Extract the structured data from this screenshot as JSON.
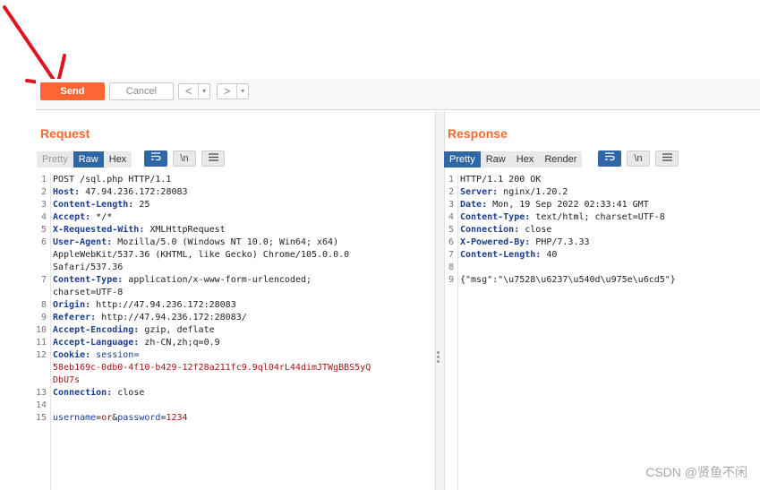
{
  "toolbar": {
    "send_label": "Send",
    "cancel_label": "Cancel",
    "back_label": "<",
    "forward_label": ">",
    "dropdown_glyph": "▾"
  },
  "request": {
    "title": "Request",
    "tabs": [
      "Pretty",
      "Raw",
      "Hex"
    ],
    "active_tab": "Raw",
    "wrap_icon": "wrap-lines-icon",
    "newline_label": "\\n",
    "menu_icon": "hamburger-menu-icon",
    "lines": [
      {
        "n": "1",
        "parts": [
          {
            "t": "POST /sql.php HTTP/1.1",
            "c": "hv"
          }
        ]
      },
      {
        "n": "2",
        "parts": [
          {
            "t": "Host:",
            "c": "hk"
          },
          {
            "t": " 47.94.236.172:28083",
            "c": "hv"
          }
        ]
      },
      {
        "n": "3",
        "parts": [
          {
            "t": "Content-Length:",
            "c": "hk"
          },
          {
            "t": " 25",
            "c": "hv"
          }
        ]
      },
      {
        "n": "4",
        "parts": [
          {
            "t": "Accept:",
            "c": "hk"
          },
          {
            "t": " */*",
            "c": "hv"
          }
        ]
      },
      {
        "n": "5",
        "parts": [
          {
            "t": "X-Requested-With:",
            "c": "hk"
          },
          {
            "t": " XMLHttpRequest",
            "c": "hv"
          }
        ]
      },
      {
        "n": "6",
        "parts": [
          {
            "t": "User-Agent:",
            "c": "hk"
          },
          {
            "t": " Mozilla/5.0 (Windows NT 10.0; Win64; x64)",
            "c": "hv"
          }
        ]
      },
      {
        "n": "",
        "parts": [
          {
            "t": "AppleWebKit/537.36 (KHTML, like Gecko) Chrome/105.0.0.0",
            "c": "hv"
          }
        ]
      },
      {
        "n": "",
        "parts": [
          {
            "t": "Safari/537.36",
            "c": "hv"
          }
        ]
      },
      {
        "n": "7",
        "parts": [
          {
            "t": "Content-Type:",
            "c": "hk"
          },
          {
            "t": " application/x-www-form-urlencoded;",
            "c": "hv"
          }
        ]
      },
      {
        "n": "",
        "parts": [
          {
            "t": "charset=UTF-8",
            "c": "hv"
          }
        ]
      },
      {
        "n": "8",
        "parts": [
          {
            "t": "Origin:",
            "c": "hk"
          },
          {
            "t": " http://47.94.236.172:28083",
            "c": "hv"
          }
        ]
      },
      {
        "n": "9",
        "parts": [
          {
            "t": "Referer:",
            "c": "hk"
          },
          {
            "t": " http://47.94.236.172:28083/",
            "c": "hv"
          }
        ]
      },
      {
        "n": "10",
        "parts": [
          {
            "t": "Accept-Encoding:",
            "c": "hk"
          },
          {
            "t": " gzip, deflate",
            "c": "hv"
          }
        ]
      },
      {
        "n": "11",
        "parts": [
          {
            "t": "Accept-Language:",
            "c": "hk"
          },
          {
            "t": " zh-CN,zh;q=0.9",
            "c": "hv"
          }
        ]
      },
      {
        "n": "12",
        "parts": [
          {
            "t": "Cookie:",
            "c": "hk"
          },
          {
            "t": " session=",
            "c": "blu"
          }
        ]
      },
      {
        "n": "",
        "parts": [
          {
            "t": "58eb169c-0db0-4f10-b429-12f28a211fc9.9ql04rL44dimJTWgBBS5yQ",
            "c": "red"
          }
        ]
      },
      {
        "n": "",
        "parts": [
          {
            "t": "DbU7s",
            "c": "red"
          }
        ]
      },
      {
        "n": "13",
        "parts": [
          {
            "t": "Connection:",
            "c": "hk"
          },
          {
            "t": " close",
            "c": "hv"
          }
        ]
      },
      {
        "n": "14",
        "parts": []
      },
      {
        "n": "15",
        "parts": [
          {
            "t": "username",
            "c": "blu"
          },
          {
            "t": "=",
            "c": "hv"
          },
          {
            "t": "or",
            "c": "red"
          },
          {
            "t": "&",
            "c": "hv"
          },
          {
            "t": "password",
            "c": "blu"
          },
          {
            "t": "=",
            "c": "hv"
          },
          {
            "t": "1234",
            "c": "red"
          }
        ]
      }
    ]
  },
  "response": {
    "title": "Response",
    "tabs": [
      "Pretty",
      "Raw",
      "Hex",
      "Render"
    ],
    "active_tab": "Pretty",
    "wrap_icon": "wrap-lines-icon",
    "newline_label": "\\n",
    "menu_icon": "hamburger-menu-icon",
    "lines": [
      {
        "n": "1",
        "parts": [
          {
            "t": "HTTP/1.1 200 OK",
            "c": "hv"
          }
        ]
      },
      {
        "n": "2",
        "parts": [
          {
            "t": "Server:",
            "c": "hk"
          },
          {
            "t": " nginx/1.20.2",
            "c": "hv"
          }
        ]
      },
      {
        "n": "3",
        "parts": [
          {
            "t": "Date:",
            "c": "hk"
          },
          {
            "t": " Mon, 19 Sep 2022 02:33:41 GMT",
            "c": "hv"
          }
        ]
      },
      {
        "n": "4",
        "parts": [
          {
            "t": "Content-Type:",
            "c": "hk"
          },
          {
            "t": " text/html; charset=UTF-8",
            "c": "hv"
          }
        ]
      },
      {
        "n": "5",
        "parts": [
          {
            "t": "Connection:",
            "c": "hk"
          },
          {
            "t": " close",
            "c": "hv"
          }
        ]
      },
      {
        "n": "6",
        "parts": [
          {
            "t": "X-Powered-By:",
            "c": "hk"
          },
          {
            "t": " PHP/7.3.33",
            "c": "hv"
          }
        ]
      },
      {
        "n": "7",
        "parts": [
          {
            "t": "Content-Length:",
            "c": "hk"
          },
          {
            "t": " 40",
            "c": "hv"
          }
        ]
      },
      {
        "n": "8",
        "parts": []
      },
      {
        "n": "9",
        "parts": [
          {
            "t": "{\"msg\":\"\\u7528\\u6237\\u540d\\u975e\\u6cd5\"}",
            "c": "hv"
          }
        ]
      }
    ]
  },
  "watermark": "CSDN @贤鱼不闲",
  "colors": {
    "accent": "#ff6633",
    "title": "#f26a34",
    "tab_active": "#2f67a5",
    "annotation": "#e0141e"
  }
}
